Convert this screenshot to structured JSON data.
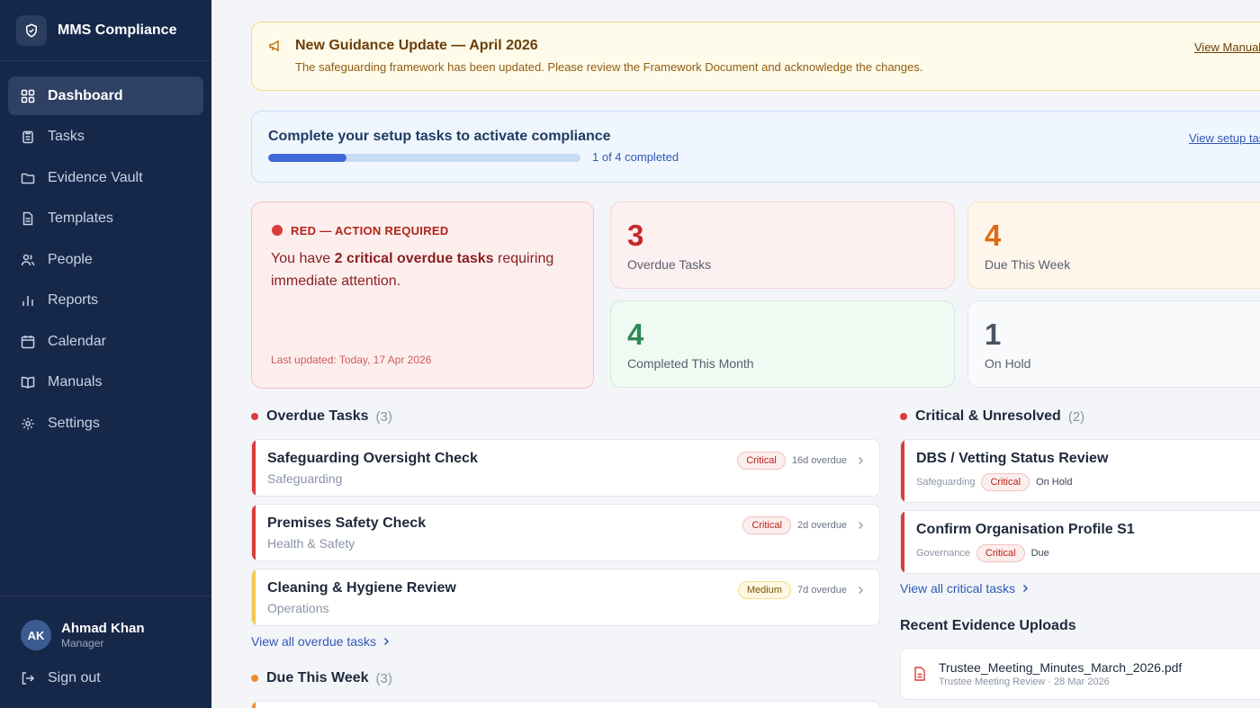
{
  "app": {
    "title": "MMS Compliance"
  },
  "sidebar": {
    "items": [
      {
        "label": "Dashboard",
        "icon": "grid-icon",
        "active": true
      },
      {
        "label": "Tasks",
        "icon": "clipboard-icon"
      },
      {
        "label": "Evidence Vault",
        "icon": "folder-icon"
      },
      {
        "label": "Templates",
        "icon": "document-icon"
      },
      {
        "label": "People",
        "icon": "people-icon"
      },
      {
        "label": "Reports",
        "icon": "bar-chart-icon"
      },
      {
        "label": "Calendar",
        "icon": "calendar-icon"
      },
      {
        "label": "Manuals",
        "icon": "book-icon"
      },
      {
        "label": "Settings",
        "icon": "gear-icon"
      }
    ]
  },
  "user": {
    "initials": "AK",
    "name": "Ahmad Khan",
    "role": "Manager",
    "signout_label": "Sign out"
  },
  "banner": {
    "title": "New Guidance Update — April 2026",
    "text": "The safeguarding framework has been updated. Please review the Framework Document and acknowledge the changes.",
    "link": "View Manual"
  },
  "setup": {
    "title": "Complete your setup tasks to activate compliance",
    "progress_fraction": 0.25,
    "count_text": "1 of 4 completed",
    "link": "View setup tasks"
  },
  "alert": {
    "heading": "RED — ACTION REQUIRED",
    "body_prefix": "You have ",
    "body_bold": "2 critical overdue tasks",
    "body_suffix": " requiring immediate attention.",
    "updated": "Last updated: Today, 17 Apr 2026"
  },
  "stats": {
    "overdue": {
      "value": "3",
      "label": "Overdue Tasks"
    },
    "due_week": {
      "value": "4",
      "label": "Due This Week"
    },
    "completed": {
      "value": "4",
      "label": "Completed This Month"
    },
    "on_hold": {
      "value": "1",
      "label": "On Hold"
    }
  },
  "overdue_section": {
    "title": "Overdue Tasks",
    "count": "(3)",
    "tasks": [
      {
        "title": "Safeguarding Oversight Check",
        "category": "Safeguarding",
        "priority": "Critical",
        "due": "16d overdue"
      },
      {
        "title": "Premises Safety Check",
        "category": "Health & Safety",
        "priority": "Critical",
        "due": "2d overdue"
      },
      {
        "title": "Cleaning & Hygiene Review",
        "category": "Operations",
        "priority": "Medium",
        "due": "7d overdue"
      }
    ],
    "view_all": "View all overdue tasks"
  },
  "due_week_section": {
    "title": "Due This Week",
    "count": "(3)"
  },
  "critical_section": {
    "title": "Critical & Unresolved",
    "count": "(2)",
    "items": [
      {
        "title": "DBS / Vetting Status Review",
        "category": "Safeguarding",
        "priority": "Critical",
        "status": "On Hold"
      },
      {
        "title": "Confirm Organisation Profile S1",
        "category": "Governance",
        "priority": "Critical",
        "status": "Due"
      }
    ],
    "view_all": "View all critical tasks"
  },
  "uploads": {
    "title": "Recent Evidence Uploads",
    "items": [
      {
        "name": "Trustee_Meeting_Minutes_March_2026.pdf",
        "meta": "Trustee Meeting Review · 28 Mar 2026"
      }
    ]
  },
  "colors": {
    "sidebar": "#16284a",
    "critical": "#dc3b3b",
    "medium": "#f2c94c",
    "accent": "#3f67d6"
  }
}
